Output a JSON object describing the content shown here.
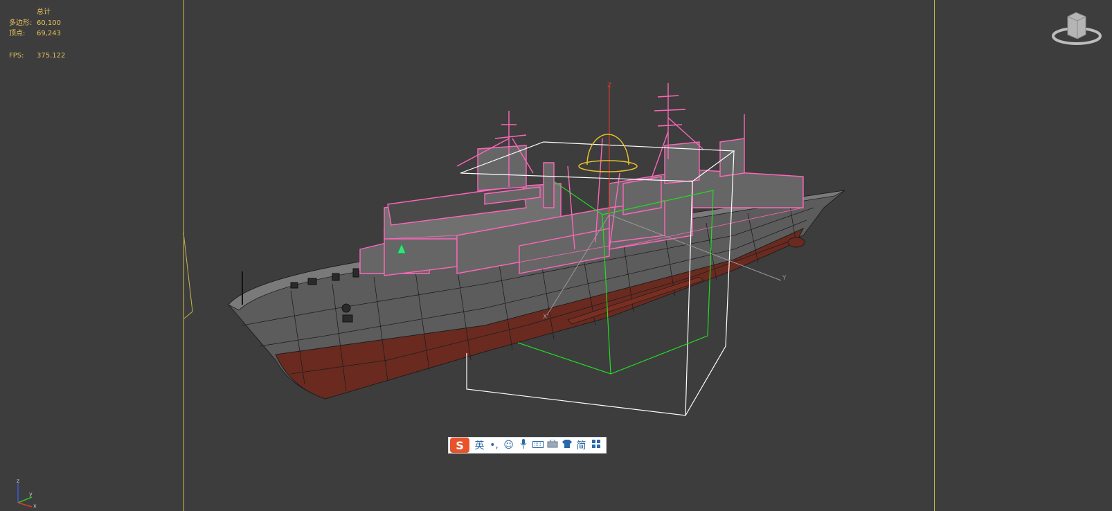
{
  "stats": {
    "title": "总计",
    "polygons_label": "多边形:",
    "polygons_value": "60,100",
    "vertices_label": "顶点:",
    "vertices_value": "69,243",
    "fps_label": "FPS:",
    "fps_value": "375.122"
  },
  "scene": {
    "object": "ship-model",
    "gizmo_axis_labels": [
      "Z",
      "Y",
      "X"
    ]
  },
  "ime_toolbar": {
    "logo": "S",
    "lang": "英",
    "punct": "•,",
    "emoji_icon": "smiley-icon",
    "voice_icon": "microphone-icon",
    "keyboard_icon": "keyboard-icon",
    "tools_icon": "toolbox-icon",
    "skin_icon": "shirt-icon",
    "mode": "简",
    "menu_icon": "grid-menu-icon"
  },
  "axis_tripod_labels": [
    "z",
    "y",
    "x"
  ],
  "colors": {
    "viewport_bg": "#3d3d3d",
    "stats_text": "#e6c25a",
    "wireframe_selected": "#ff66bb",
    "safe_frame": "#c9b84a",
    "bbox_white": "#ffffff",
    "bbox_green": "#22dd22",
    "hull_red": "#6b2a1e",
    "hull_gray": "#5e5e5e"
  }
}
